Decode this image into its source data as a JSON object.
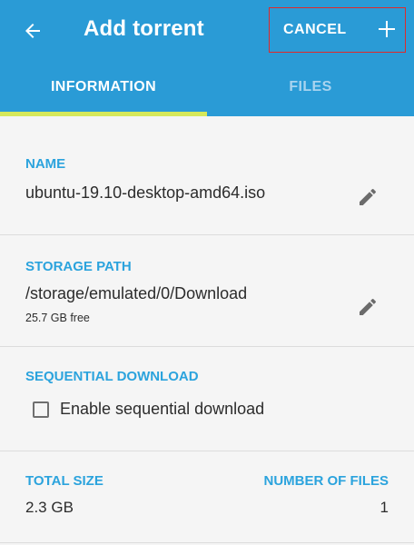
{
  "appbar": {
    "title": "Add torrent",
    "cancel_label": "CANCEL"
  },
  "tabs": [
    {
      "label": "INFORMATION"
    },
    {
      "label": "FILES"
    }
  ],
  "name_section": {
    "label": "NAME",
    "value": "ubuntu-19.10-desktop-amd64.iso"
  },
  "storage_section": {
    "label": "STORAGE PATH",
    "value": "/storage/emulated/0/Download",
    "free": "25.7 GB free"
  },
  "sequential_section": {
    "label": "SEQUENTIAL DOWNLOAD",
    "checkbox_label": "Enable sequential download",
    "checked": false
  },
  "size_section": {
    "total_size_label": "TOTAL SIZE",
    "total_size_value": "2.3 GB",
    "num_files_label": "NUMBER OF FILES",
    "num_files_value": "1"
  },
  "icons": {
    "back": "arrow-back-icon",
    "add": "plus-icon",
    "edit": "pencil-icon"
  },
  "colors": {
    "appbar": "#2a9bd6",
    "accent_label": "#2ba3dd",
    "tab_indicator": "#d6e85a",
    "highlight": "#e02a2a"
  }
}
